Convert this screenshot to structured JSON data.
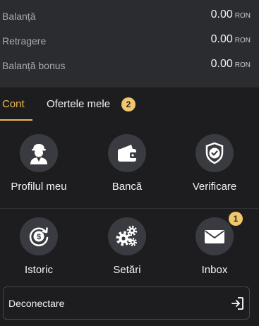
{
  "balances": {
    "currency": "RON",
    "rows": [
      {
        "label": "Balanță",
        "amount": "0.00"
      },
      {
        "label": "Retragere",
        "amount": "0.00"
      },
      {
        "label": "Balanță bonus",
        "amount": "0.00"
      }
    ]
  },
  "tabs": [
    {
      "label": "Cont",
      "active": true
    },
    {
      "label": "Ofertele mele",
      "badge": "2"
    }
  ],
  "tiles": [
    {
      "label": "Profilul meu",
      "icon": "user-icon"
    },
    {
      "label": "Bancă",
      "icon": "wallet-icon"
    },
    {
      "label": "Verificare",
      "icon": "shield-check-icon"
    },
    {
      "label": "Istoric",
      "icon": "history-money-icon"
    },
    {
      "label": "Setări",
      "icon": "gears-icon"
    },
    {
      "label": "Inbox",
      "icon": "envelope-icon",
      "badge": "1"
    }
  ],
  "logout": {
    "label": "Deconectare",
    "icon": "logout-icon"
  },
  "colors": {
    "accent": "#f0b94a",
    "badge": "#f2c66b",
    "background": "#1d1d20",
    "panel": "#2b2c30",
    "icon_circle": "#3a3b40"
  }
}
